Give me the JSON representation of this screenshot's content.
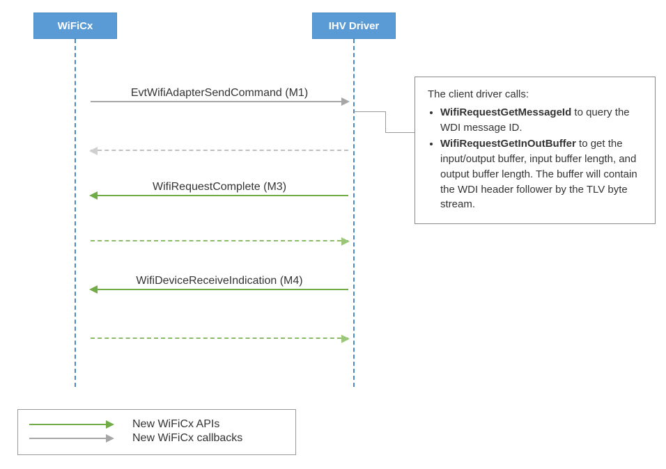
{
  "participants": {
    "left": "WiFiCx",
    "right": "IHV Driver"
  },
  "messages": {
    "m1": "EvtWifiAdapterSendCommand (M1)",
    "m3": "WifiRequestComplete (M3)",
    "m4": "WifiDeviceReceiveIndication (M4)"
  },
  "note": {
    "intro": "The client driver calls:",
    "item1_bold": "WifiRequestGetMessageId",
    "item1_rest": " to query the WDI message ID.",
    "item2_bold": "WifiRequestGetInOutBuffer",
    "item2_rest": " to get the input/output buffer, input buffer length, and output buffer length. The buffer will contain the WDI header follower by the TLV byte stream."
  },
  "legend": {
    "apis": "New WiFiCx APIs",
    "callbacks": "New WiFiCx callbacks"
  }
}
